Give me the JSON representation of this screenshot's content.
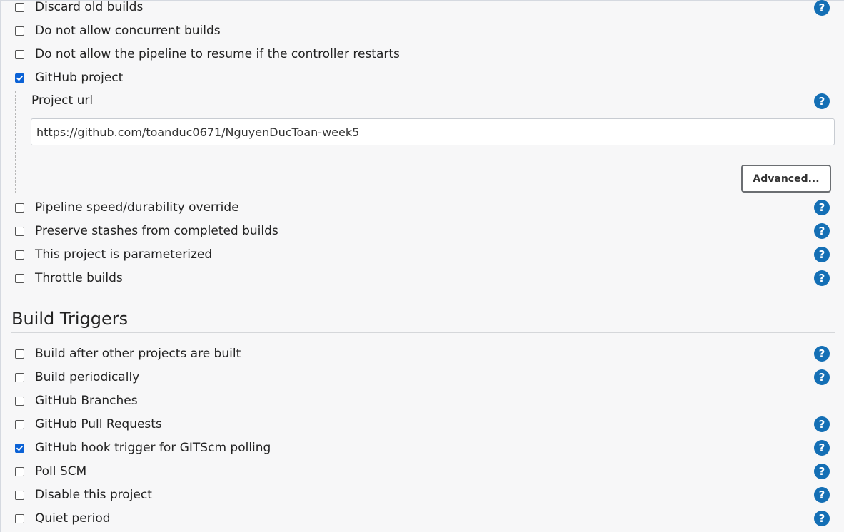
{
  "general": {
    "discard_old_builds": {
      "label": "Discard old builds",
      "checked": false,
      "help": "?"
    },
    "no_concurrent": {
      "label": "Do not allow concurrent builds",
      "checked": false
    },
    "no_resume": {
      "label": "Do not allow the pipeline to resume if the controller restarts",
      "checked": false
    },
    "github_project": {
      "label": "GitHub project",
      "checked": true,
      "project_url_label": "Project url",
      "project_url_value": "https://github.com/toanduc0671/NguyenDucToan-week5",
      "help": "?",
      "advanced_button": "Advanced..."
    },
    "durability_override": {
      "label": "Pipeline speed/durability override",
      "checked": false,
      "help": "?"
    },
    "preserve_stashes": {
      "label": "Preserve stashes from completed builds",
      "checked": false,
      "help": "?"
    },
    "parameterized": {
      "label": "This project is parameterized",
      "checked": false,
      "help": "?"
    },
    "throttle": {
      "label": "Throttle builds",
      "checked": false,
      "help": "?"
    }
  },
  "build_triggers": {
    "title": "Build Triggers",
    "after_other": {
      "label": "Build after other projects are built",
      "checked": false,
      "help": "?"
    },
    "periodically": {
      "label": "Build periodically",
      "checked": false,
      "help": "?"
    },
    "github_branches": {
      "label": "GitHub Branches",
      "checked": false
    },
    "github_pull_requests": {
      "label": "GitHub Pull Requests",
      "checked": false,
      "help": "?"
    },
    "github_hook": {
      "label": "GitHub hook trigger for GITScm polling",
      "checked": true,
      "help": "?"
    },
    "poll_scm": {
      "label": "Poll SCM",
      "checked": false,
      "help": "?"
    },
    "disable_project": {
      "label": "Disable this project",
      "checked": false,
      "help": "?"
    },
    "quiet_period": {
      "label": "Quiet period",
      "checked": false,
      "help": "?"
    }
  },
  "colors": {
    "help_icon": "#146fb5",
    "checkbox_checked": "#0b62d6",
    "background": "#f7f7f8"
  },
  "icons": {
    "help": "question-circle-icon",
    "check": "checkmark-icon"
  }
}
